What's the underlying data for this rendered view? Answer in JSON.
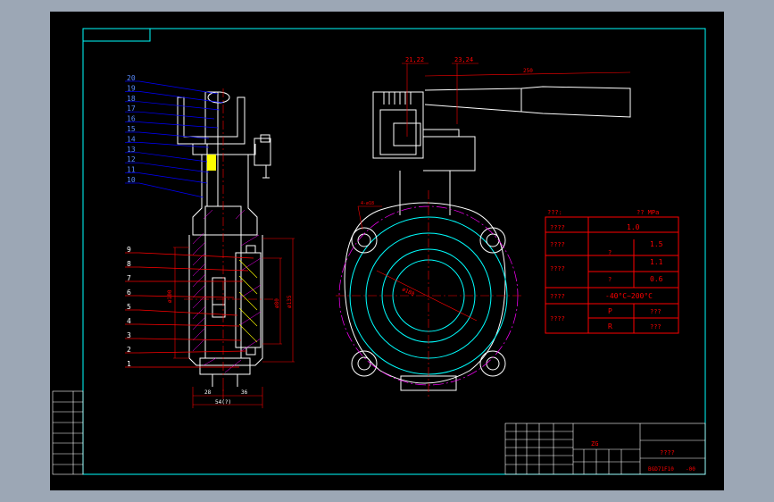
{
  "colors": {
    "background": "#9ca7b5",
    "sheet": "#000000",
    "frame": "#00ffff",
    "section": "#ffffff",
    "dim": "#ff0000",
    "leader": "#0000ff",
    "hatch": "#ff00ff",
    "label": "#5a8cff",
    "yellow": "#ffff00"
  },
  "section_view": {
    "balloons_blue": [
      "20",
      "19",
      "18",
      "17",
      "16",
      "15",
      "14",
      "13",
      "12",
      "11",
      "10"
    ],
    "balloons_red": [
      "9",
      "8",
      "7",
      "6",
      "5",
      "4",
      "3",
      "2",
      "1"
    ],
    "dims": {
      "d1": "ø100",
      "d2": "ø80",
      "d3": "ø135",
      "bottom_a": "28",
      "bottom_b": "36",
      "bottom_total": "54(?)"
    }
  },
  "front_view": {
    "callout_a": "21,22",
    "callout_b": "23,24",
    "handle_len": "250",
    "bolt_note": "4-ø18",
    "pcd": "ø180"
  },
  "spec_table": {
    "header_left": "???:",
    "header_right": "??  MPa",
    "rows": [
      {
        "label": "????",
        "col2": "",
        "value": "1.0"
      },
      {
        "label": "????",
        "col2": "?",
        "value": "1.5"
      },
      {
        "label": "",
        "col2": "",
        "value": "1.1"
      },
      {
        "label": "????",
        "col2": "?",
        "value": "0.6"
      },
      {
        "label": "????",
        "col2": "",
        "value": "-40°C~200°C"
      },
      {
        "label": "????",
        "col2": "P",
        "value": "???"
      },
      {
        "label": "",
        "col2": "R",
        "value": "???"
      }
    ]
  },
  "title_block": {
    "material": "ZG",
    "title": "????",
    "drawing_no": "BGD71F10",
    "drawing_suffix": "-00"
  }
}
